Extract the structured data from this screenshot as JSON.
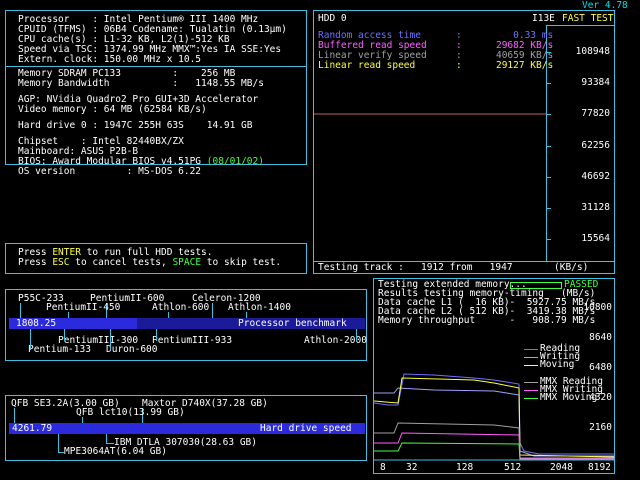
{
  "version": "Ver 4.78",
  "sysinfo": {
    "lines": [
      "Processor    : Intel Pentium® III 1400 MHz",
      "CPUID (TFMS) : 06B4 Codename: Tualatin (0.13µm)",
      "CPU cache(s) : L1-32 KB, L2(1)-512 KB",
      "Speed via TSC: 1374.99 MHz MMX™:Yes IA SSE:Yes",
      "Extern. clock: 150.00 MHz x 10.5"
    ],
    "memory": [
      "Memory SDRAM PC133         :    256 MB",
      "Memory Bandwidth           :   1148.55 MB/s"
    ],
    "video": [
      "AGP: NVidia Quadro2 Pro GUI+3D Accelerator",
      "Video memory : 64 MB (62584 KB/s)"
    ],
    "hdd": "Hard drive 0 : 1947C 255H 63S    14.91 GB",
    "chipset": [
      "Chipset    : Intel 82440BX/ZX",
      "Mainboard: ASUS P2B-B"
    ],
    "bios_prefix": "BIOS: Award Modular BIOS v4.51PG ",
    "bios_date": "(08/01/02)",
    "os": "OS version         : MS-DOS 6.22"
  },
  "prompt": {
    "l1_a": "Press ",
    "l1_key": "ENTER",
    "l1_b": " to run full HDD tests.",
    "l2_a": "Press ",
    "l2_key1": "ESC",
    "l2_b": " to cancel tests, ",
    "l2_key2": "SPACE",
    "l2_c": " to skip test."
  },
  "hdd_test": {
    "title": "HDD 0",
    "i13e": "I13E",
    "fast": "FAST TEST",
    "results": [
      {
        "label": "Random access time",
        "value": "0.33 ms",
        "color": "#7070ff"
      },
      {
        "label": "Buffered read speed",
        "value": "29682 KB/s",
        "color": "#ff60ff"
      },
      {
        "label": "Linear verify speed",
        "value": "40659 KB/s",
        "color": "#a0a0a0"
      },
      {
        "label": "Linear read speed",
        "value": "29127 KB/s",
        "color": "#ffff40"
      }
    ],
    "y_ticks": [
      "108948",
      "93384",
      "77820",
      "62256",
      "46692",
      "31128",
      "15564"
    ],
    "footer_label": "Testing track :",
    "footer_track": "1912",
    "footer_from": "from",
    "footer_total": "1947",
    "footer_unit": "(KB/s)"
  },
  "memtest": {
    "title": "Testing extended memory...",
    "passed": "PASSED",
    "results_line": "Results testing memory-timing   (MB/s)",
    "rows": [
      "Data cache L1 (  16 KB)-  5927.75 MB/s",
      "Data cache L2 ( 512 KB)-  3419.38 MB/s",
      "Memory throughput      -   908.79 MB/s"
    ],
    "y_ticks": [
      "10800",
      "8640",
      "6480",
      "4320",
      "2160"
    ],
    "x_ticks": [
      "8",
      "32",
      "128",
      "512",
      "2048",
      "8192"
    ],
    "legend1": [
      "Reading",
      "Writing",
      "Moving"
    ],
    "legend2": [
      "MMX Reading",
      "MMX Writing",
      "MMX Moving"
    ],
    "colors": {
      "reading": "#7070ff",
      "writing": "#a0a0ff",
      "moving": "#ffff40",
      "mmx_reading": "#a0a0a0",
      "mmx_writing": "#ff60ff",
      "mmx_moving": "#40ff40"
    }
  },
  "cpu_bench": {
    "value": "1808.25",
    "label": "Processor benchmark",
    "value_fraction": 0.36,
    "above": [
      "P55C-233",
      "PentiumII-600",
      "Celeron-1200",
      "PentiumII-450",
      "Athlon-600",
      "Athlon-1400"
    ],
    "below": [
      "PentiumIII-300",
      "PentiumIII-933",
      "Athlon-2000",
      "Pentium-133",
      "Duron-600"
    ]
  },
  "hdd_bench": {
    "value": "4261.79",
    "label": "Hard drive speed",
    "value_fraction": 1.0,
    "above": [
      "QFB SE3.2A(3.00 GB)",
      "Maxtor D740X(37.28 GB)",
      "QFB lct10(13.99 GB)"
    ],
    "below": [
      "IBM DTLA 307030(28.63 GB)",
      "MPE3064AT(6.04 GB)"
    ]
  }
}
